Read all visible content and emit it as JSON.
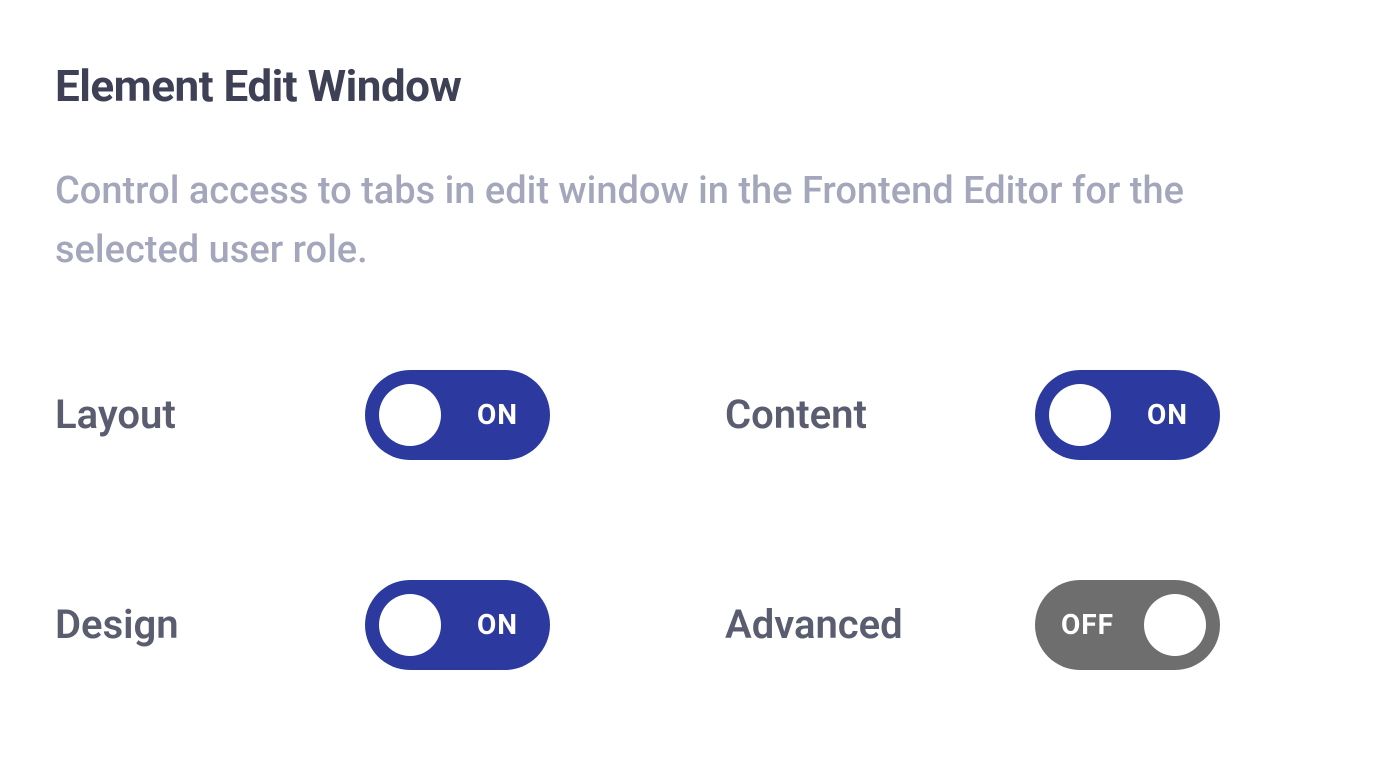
{
  "section": {
    "title": "Element Edit Window",
    "description": "Control access to tabs in edit window in the Frontend Editor for the selected user role."
  },
  "toggles": {
    "layout": {
      "label": "Layout",
      "state": "on",
      "state_text": "ON"
    },
    "content": {
      "label": "Content",
      "state": "on",
      "state_text": "ON"
    },
    "design": {
      "label": "Design",
      "state": "on",
      "state_text": "ON"
    },
    "advanced": {
      "label": "Advanced",
      "state": "off",
      "state_text": "OFF"
    }
  },
  "colors": {
    "toggle_on_bg": "#2c3aa0",
    "toggle_off_bg": "#6e6e6e",
    "title_color": "#3e4056",
    "description_color": "#a4a7bc",
    "label_color": "#5a5d70"
  }
}
